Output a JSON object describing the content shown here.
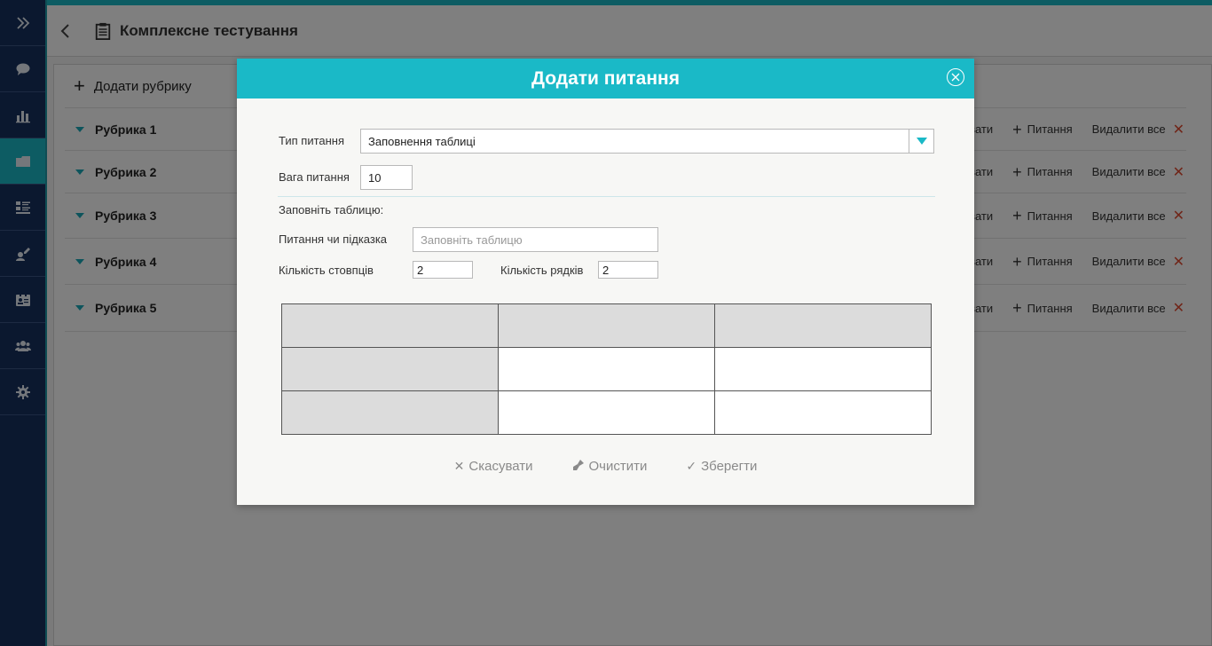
{
  "header": {
    "title": "Комплексне тестування"
  },
  "sidebar": {
    "items": [
      {
        "icon": "double-chevron-right-icon"
      },
      {
        "icon": "chat-icon"
      },
      {
        "icon": "bar-chart-icon"
      },
      {
        "icon": "folder-icon",
        "active": true
      },
      {
        "icon": "list-icon"
      },
      {
        "icon": "user-edit-icon"
      },
      {
        "icon": "id-card-icon"
      },
      {
        "icon": "users-icon"
      },
      {
        "icon": "gear-icon"
      }
    ]
  },
  "main": {
    "add_rubric_label": "Додати рубрику",
    "rubrics": [
      {
        "name": "Рубрика 1",
        "actions": {
          "edit": "гувати",
          "add": "Питання",
          "delete_all": "Видалити все"
        }
      },
      {
        "name": "Рубрика 2",
        "actions": {
          "edit": "гувати",
          "add": "Питання",
          "delete_all": "Видалити все"
        }
      },
      {
        "name": "Рубрика 3",
        "actions": {
          "edit": "гувати",
          "add": "Питання",
          "delete_all": "Видалити все"
        }
      },
      {
        "name": "Рубрика 4",
        "actions": {
          "edit": "гувати",
          "add": "Питання",
          "delete_all": "Видалити все"
        }
      },
      {
        "name": "Рубрика 5",
        "actions": {
          "edit": "гувати",
          "add": "Питання",
          "delete_all": "Видалити все"
        }
      }
    ]
  },
  "modal": {
    "title": "Додати питання",
    "question_type_label": "Тип питання",
    "question_type_value": "Заповнення таблиці",
    "weight_label": "Вага питання",
    "weight_value": "10",
    "fill_table_label": "Заповніть таблицю:",
    "prompt_label": "Питання чи підказка",
    "prompt_placeholder": "Заповніть таблицю",
    "columns_label": "Кількість стовпців",
    "columns_value": "2",
    "rows_label": "Кількість рядків",
    "rows_value": "2",
    "buttons": {
      "cancel": "Скасувати",
      "clear": "Очистити",
      "save": "Зберегти"
    }
  },
  "colors": {
    "accent": "#1ab9c7",
    "sidebar": "#17315e",
    "danger": "#e04a30"
  }
}
